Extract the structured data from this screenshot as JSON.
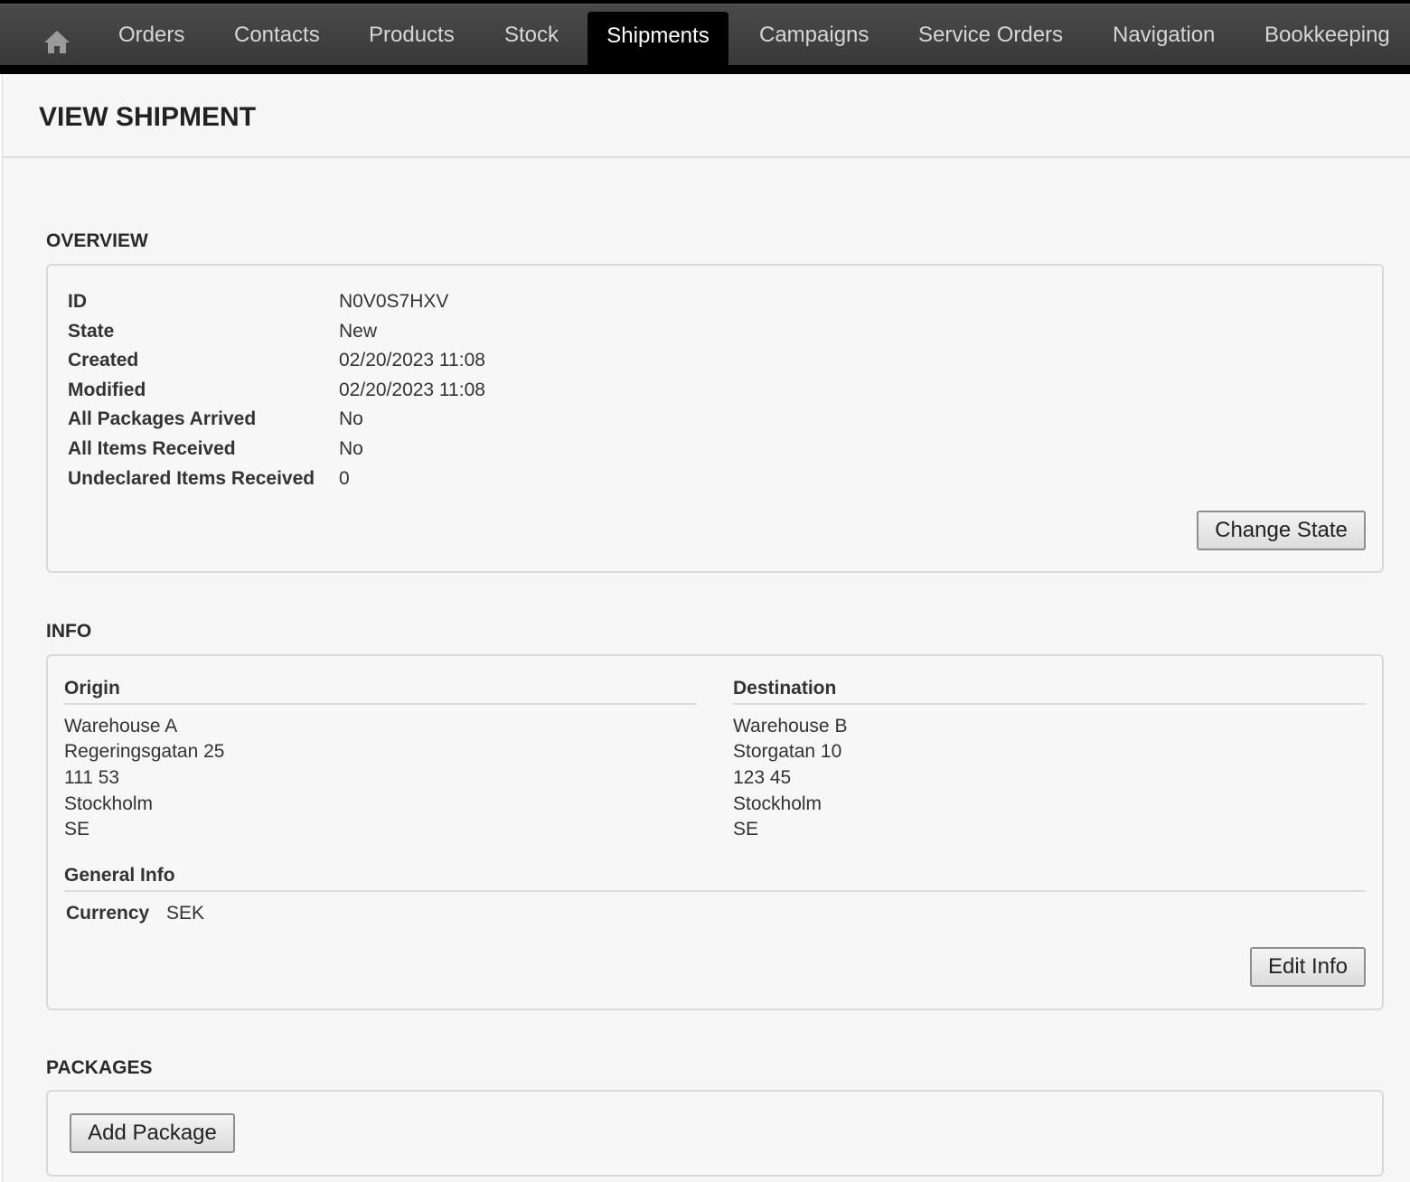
{
  "nav": {
    "home_icon": "home-icon",
    "items": [
      {
        "label": "Orders"
      },
      {
        "label": "Contacts"
      },
      {
        "label": "Products"
      },
      {
        "label": "Stock"
      },
      {
        "label": "Shipments",
        "active": true
      },
      {
        "label": "Campaigns"
      },
      {
        "label": "Service Orders"
      },
      {
        "label": "Navigation"
      },
      {
        "label": "Bookkeeping"
      }
    ]
  },
  "page": {
    "title": "VIEW SHIPMENT"
  },
  "overview": {
    "heading": "OVERVIEW",
    "fields": [
      {
        "label": "ID",
        "value": "N0V0S7HXV"
      },
      {
        "label": "State",
        "value": "New"
      },
      {
        "label": "Created",
        "value": "02/20/2023 11:08"
      },
      {
        "label": "Modified",
        "value": "02/20/2023 11:08"
      },
      {
        "label": "All Packages Arrived",
        "value": "No"
      },
      {
        "label": "All Items Received",
        "value": "No"
      },
      {
        "label": "Undeclared Items Received",
        "value": "0"
      }
    ],
    "change_state_label": "Change State"
  },
  "info": {
    "heading": "INFO",
    "origin": {
      "heading": "Origin",
      "lines": [
        "Warehouse A",
        "Regeringsgatan 25",
        "111 53",
        "Stockholm",
        "SE"
      ]
    },
    "destination": {
      "heading": "Destination",
      "lines": [
        "Warehouse B",
        "Storgatan 10",
        "123 45",
        "Stockholm",
        "SE"
      ]
    },
    "general": {
      "heading": "General Info",
      "currency_label": "Currency",
      "currency_value": "SEK"
    },
    "edit_info_label": "Edit Info"
  },
  "packages": {
    "heading": "PACKAGES",
    "add_package_label": "Add Package"
  },
  "colors": {
    "nav_bg": "#3f3f3f",
    "nav_active": "#000000",
    "page_bg": "#f6f6f6"
  }
}
